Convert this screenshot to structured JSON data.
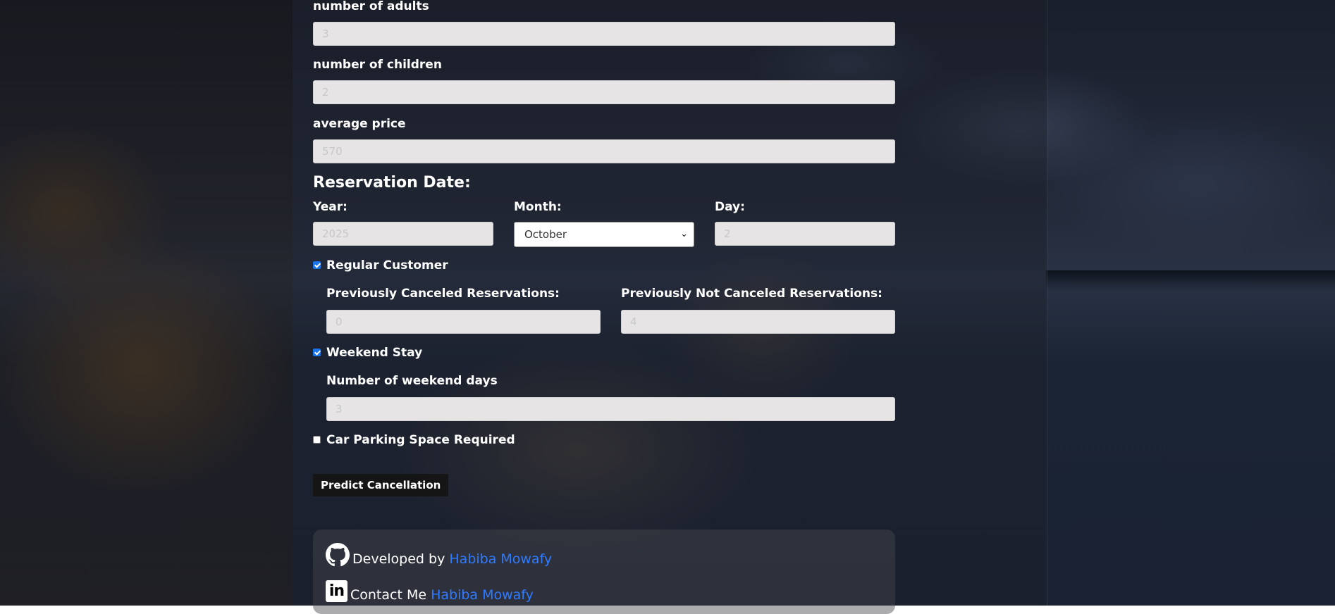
{
  "form": {
    "adults": {
      "label": "number of adults",
      "value": "3"
    },
    "children": {
      "label": "number of children",
      "value": "2"
    },
    "price": {
      "label": "average price",
      "value": "570"
    },
    "reservation_title": "Reservation Date:",
    "year": {
      "label": "Year:",
      "value": "2025"
    },
    "month": {
      "label": "Month:",
      "selected": "October"
    },
    "day": {
      "label": "Day:",
      "value": "2"
    },
    "regular_customer": {
      "label": "Regular Customer",
      "checked": true,
      "prev_canceled": {
        "label": "Previously Canceled Reservations:",
        "value": "0"
      },
      "prev_not_canceled": {
        "label": "Previously Not Canceled Reservations:",
        "value": "4"
      }
    },
    "weekend_stay": {
      "label": "Weekend Stay",
      "checked": true,
      "weekend_days": {
        "label": "Number of weekend days",
        "value": "3"
      }
    },
    "car_parking": {
      "label": "Car Parking Space Required",
      "checked": false
    },
    "submit_label": "Predict Cancellation"
  },
  "footer": {
    "developed_prefix": "Developed by",
    "developer_name": "Habiba Mowafy",
    "contact_prefix": "Contact Me",
    "contact_name": "Habiba Mowafy"
  },
  "colors": {
    "link": "#2f7bff",
    "field_bg": "#e6e4e4",
    "button_bg": "#151515",
    "checkbox_accent": "#1a73e8"
  },
  "icons": {
    "developer": "github-icon",
    "contact": "linkedin-icon",
    "select_arrow": "chevron-down-icon",
    "checkbox": "checkmark-icon"
  }
}
